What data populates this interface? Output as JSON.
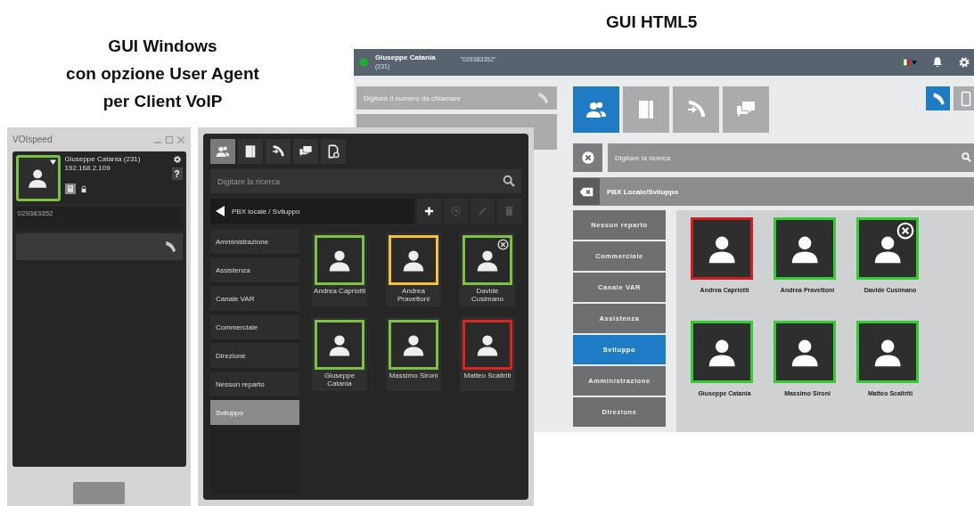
{
  "captions": {
    "windows": [
      "GUI Windows",
      "con opzione User Agent",
      "per Client VoIP"
    ],
    "html5": "GUI HTML5"
  },
  "html5_gui": {
    "header": {
      "name": "Giuseppe Catania",
      "extension": "(231)",
      "number": "\"029383352\""
    },
    "dial_field": {
      "placeholder": "Digitare il numero da chiamare"
    },
    "tabs": [
      {
        "selected": true
      },
      {
        "selected": false
      },
      {
        "selected": false
      },
      {
        "selected": false
      }
    ],
    "right_buttons": [
      {
        "selected": true
      },
      {
        "selected": false
      }
    ],
    "search": {
      "placeholder": "Digitare la ricerca"
    },
    "breadcrumb": "PBX Locale/Sviluppo",
    "departments": [
      {
        "label": "Nessun reparto",
        "selected": false
      },
      {
        "label": "Commerciale",
        "selected": false
      },
      {
        "label": "Canale VAR",
        "selected": false
      },
      {
        "label": "Assistenza",
        "selected": false
      },
      {
        "label": "Sviluppo",
        "selected": true
      },
      {
        "label": "Amministrazione",
        "selected": false
      },
      {
        "label": "Direzione",
        "selected": false
      }
    ],
    "contacts": [
      {
        "name": "Andrea Capriotti",
        "color": "#cc1f1f",
        "dnd": false
      },
      {
        "name": "Andrea Pravettoni",
        "color": "#33cc33",
        "dnd": false
      },
      {
        "name": "Davide Cusimano",
        "color": "#33cc33",
        "dnd": true
      },
      {
        "name": "Giuseppe Catania",
        "color": "#33cc33",
        "dnd": false
      },
      {
        "name": "Massimo Sironi",
        "color": "#33cc33",
        "dnd": false
      },
      {
        "name": "Matteo Scaltriti",
        "color": "#33cc33",
        "dnd": false
      }
    ]
  },
  "windows_gui": {
    "softphone": {
      "title": "VOIspeed",
      "name": "Giuseppe Catania (231)",
      "ip": "192.168.2.109",
      "help_label": "?",
      "number": "029383352"
    },
    "contacts_window": {
      "tabs": [
        {
          "selected": true
        },
        {
          "selected": false
        },
        {
          "selected": false
        },
        {
          "selected": false
        },
        {
          "selected": false
        }
      ],
      "search": {
        "placeholder": "Digitare la ricerca"
      },
      "breadcrumb": "PBX locale / Sviluppo",
      "departments": [
        {
          "label": "Amministrazione",
          "selected": false
        },
        {
          "label": "Assistenza",
          "selected": false
        },
        {
          "label": "Canale VAR",
          "selected": false
        },
        {
          "label": "Commerciale",
          "selected": false
        },
        {
          "label": "Direzione",
          "selected": false
        },
        {
          "label": "Nessun reparto",
          "selected": false
        },
        {
          "label": "Sviluppo",
          "selected": true
        }
      ],
      "contacts": [
        {
          "name": "Andrea Capriotti",
          "color": "#7cc242",
          "dnd": false
        },
        {
          "name": "Andrea Pravettoni",
          "color": "#f2c230",
          "dnd": false
        },
        {
          "name": "Davide Cusimano",
          "color": "#7cc242",
          "dnd": true
        },
        {
          "name": "Giuseppe Catania",
          "color": "#7cc242",
          "dnd": false
        },
        {
          "name": "Massimo Sironi",
          "color": "#7cc242",
          "dnd": false
        },
        {
          "name": "Matteo Scaltriti",
          "color": "#dd2222",
          "dnd": false
        }
      ]
    }
  }
}
